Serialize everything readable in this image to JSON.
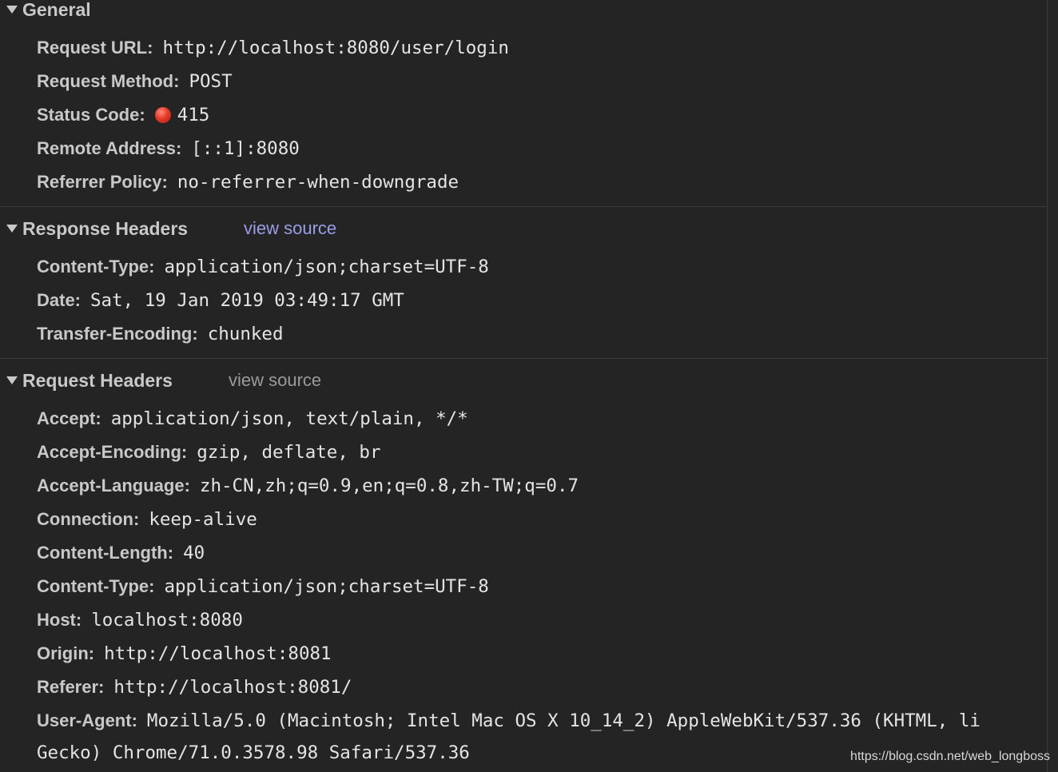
{
  "colors": {
    "background": "#242424",
    "divider": "#3b3b3b",
    "link_active": "#9b9de6",
    "link_muted": "#9a9a9a",
    "status_error": "#e53a2a"
  },
  "general": {
    "title": "General",
    "rows": [
      {
        "key": "Request URL:",
        "value": "http://localhost:8080/user/login"
      },
      {
        "key": "Request Method:",
        "value": "POST"
      },
      {
        "key": "Status Code:",
        "value": "415",
        "icon": "status-error-dot-icon"
      },
      {
        "key": "Remote Address:",
        "value": "[::1]:8080"
      },
      {
        "key": "Referrer Policy:",
        "value": "no-referrer-when-downgrade"
      }
    ]
  },
  "response_headers": {
    "title": "Response Headers",
    "view_source": "view source",
    "rows": [
      {
        "key": "Content-Type:",
        "value": "application/json;charset=UTF-8"
      },
      {
        "key": "Date:",
        "value": "Sat, 19 Jan 2019 03:49:17 GMT"
      },
      {
        "key": "Transfer-Encoding:",
        "value": "chunked"
      }
    ]
  },
  "request_headers": {
    "title": "Request Headers",
    "view_source": "view source",
    "rows": [
      {
        "key": "Accept:",
        "value": "application/json, text/plain, */*"
      },
      {
        "key": "Accept-Encoding:",
        "value": "gzip, deflate, br"
      },
      {
        "key": "Accept-Language:",
        "value": "zh-CN,zh;q=0.9,en;q=0.8,zh-TW;q=0.7"
      },
      {
        "key": "Connection:",
        "value": "keep-alive"
      },
      {
        "key": "Content-Length:",
        "value": "40"
      },
      {
        "key": "Content-Type:",
        "value": "application/json;charset=UTF-8"
      },
      {
        "key": "Host:",
        "value": "localhost:8080"
      },
      {
        "key": "Origin:",
        "value": "http://localhost:8081"
      },
      {
        "key": "Referer:",
        "value": "http://localhost:8081/"
      },
      {
        "key": "User-Agent:",
        "value": "Mozilla/5.0 (Macintosh; Intel Mac OS X 10_14_2) AppleWebKit/537.36 (KHTML, li",
        "value_continued": "Gecko) Chrome/71.0.3578.98 Safari/537.36"
      }
    ]
  },
  "watermark": "https://blog.csdn.net/web_longboss"
}
